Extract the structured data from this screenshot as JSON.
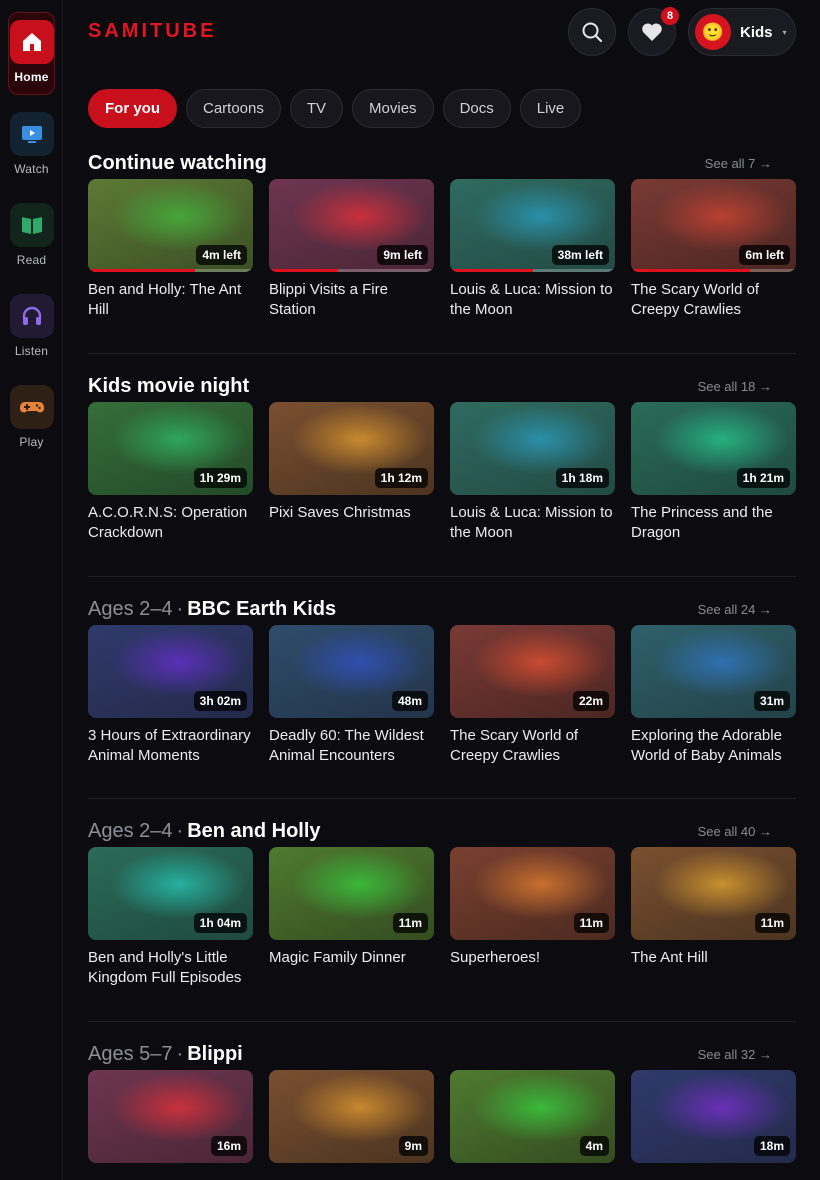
{
  "brand": "SAMITUBE",
  "nav": [
    {
      "label": "Home",
      "icon": "home-icon",
      "color": "#c8101d"
    },
    {
      "label": "Watch",
      "icon": "tv-icon",
      "color": "#3b8fe0"
    },
    {
      "label": "Read",
      "icon": "book-icon",
      "color": "#2faa6a"
    },
    {
      "label": "Listen",
      "icon": "headphones-icon",
      "color": "#8f6ae8"
    },
    {
      "label": "Play",
      "icon": "gamepad-icon",
      "color": "#e8843a"
    }
  ],
  "header": {
    "favorites_count": "8",
    "profile_name": "Kids",
    "avatar_glyph": "🙂"
  },
  "tabs": [
    "For you",
    "Cartoons",
    "TV",
    "Movies",
    "Docs",
    "Live"
  ],
  "sections": [
    {
      "age": "",
      "title": "Continue watching",
      "see_all": "See all 7 →",
      "items": [
        {
          "title": "Ben and Holly: The Ant Hill",
          "badge": "4m left",
          "progress": 0.65,
          "colors": [
            "#5d7a35",
            "#46a63a",
            "#3a4f25"
          ]
        },
        {
          "title": "Blippi Visits a Fire Station",
          "badge": "9m left",
          "progress": 0.42,
          "colors": [
            "#6e3550",
            "#c8303c",
            "#4a2636"
          ]
        },
        {
          "title": "Louis & Luca: Mission to the Moon",
          "badge": "38m left",
          "progress": 0.5,
          "colors": [
            "#2f6b60",
            "#2a8fa8",
            "#234a45"
          ]
        },
        {
          "title": "The Scary World of Creepy Crawlies",
          "badge": "6m left",
          "progress": 0.72,
          "colors": [
            "#7a3a35",
            "#b84030",
            "#4c2622"
          ]
        }
      ]
    },
    {
      "age": "",
      "title": "Kids movie night",
      "see_all": "See all 18 →",
      "items": [
        {
          "title": "A.C.O.R.N.S: Operation Crackdown",
          "badge": "1h 29m",
          "colors": [
            "#356e3a",
            "#2fa65a",
            "#244a28"
          ]
        },
        {
          "title": "Pixi Saves Christmas",
          "badge": "1h 12m",
          "colors": [
            "#7a4f30",
            "#c88a2e",
            "#4c3420"
          ]
        },
        {
          "title": "Louis & Luca: Mission to the Moon",
          "badge": "1h 18m",
          "colors": [
            "#2f6b60",
            "#2a8fa8",
            "#234a45"
          ]
        },
        {
          "title": "The Princess and the Dragon",
          "badge": "1h 21m",
          "colors": [
            "#2a6b58",
            "#26b080",
            "#1f4a3e"
          ]
        }
      ]
    },
    {
      "age": "Ages 2–4",
      "title": "BBC Earth Kids",
      "see_all": "See all 24 →",
      "items": [
        {
          "title": "3 Hours of Extraordinary Animal Moments",
          "badge": "3h 02m",
          "colors": [
            "#2f3a6b",
            "#5a2fb8",
            "#232a4a"
          ]
        },
        {
          "title": "Deadly 60: The Wildest Animal Encounters",
          "badge": "48m",
          "colors": [
            "#2f4c6b",
            "#2f4fb0",
            "#23344a"
          ]
        },
        {
          "title": "The Scary World of Creepy Crawlies",
          "badge": "22m",
          "colors": [
            "#7a3a35",
            "#c84a30",
            "#4c2622"
          ]
        },
        {
          "title": "Exploring the Adorable World of Baby Animals",
          "badge": "31m",
          "colors": [
            "#2f606b",
            "#2f70b0",
            "#234248"
          ]
        }
      ]
    },
    {
      "age": "Ages 2–4",
      "title": "Ben and Holly",
      "see_all": "See all 40 →",
      "items": [
        {
          "title": "Ben and Holly's Little Kingdom Full Episodes",
          "badge": "1h 04m",
          "colors": [
            "#2a6b58",
            "#26b0a0",
            "#1f4a3e"
          ]
        },
        {
          "title": "Magic Family Dinner",
          "badge": "11m",
          "colors": [
            "#4f7a30",
            "#3ab83a",
            "#344c20"
          ]
        },
        {
          "title": "Superheroes!",
          "badge": "11m",
          "colors": [
            "#7a4030",
            "#c8702e",
            "#4c2a20"
          ]
        },
        {
          "title": "The Ant Hill",
          "badge": "11m",
          "colors": [
            "#7a5030",
            "#c8902e",
            "#4c3420"
          ]
        }
      ]
    },
    {
      "age": "Ages 5–7",
      "title": "Blippi",
      "see_all": "See all 32 →",
      "items": [
        {
          "title": "",
          "badge": "16m",
          "colors": [
            "#6e3550",
            "#c8303c",
            "#4a2636"
          ]
        },
        {
          "title": "",
          "badge": "9m",
          "colors": [
            "#7a4f30",
            "#c8882e",
            "#4c3420"
          ]
        },
        {
          "title": "",
          "badge": "4m",
          "colors": [
            "#4f7a30",
            "#3ab83a",
            "#344c20"
          ]
        },
        {
          "title": "",
          "badge": "18m",
          "colors": [
            "#2f3a6b",
            "#6a2fb8",
            "#232a4a"
          ]
        }
      ]
    }
  ]
}
